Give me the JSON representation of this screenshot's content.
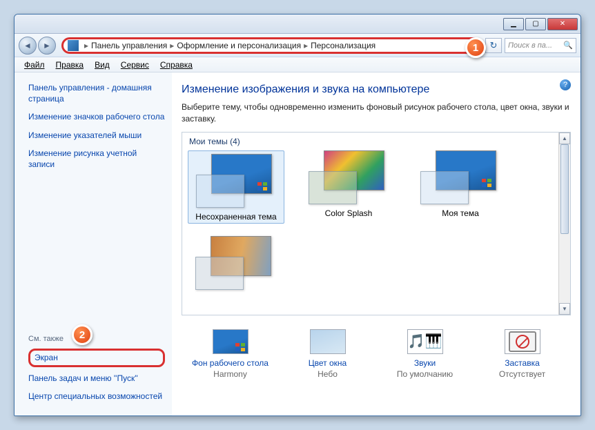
{
  "breadcrumb": {
    "items": [
      "Панель управления",
      "Оформление и персонализация",
      "Персонализация"
    ]
  },
  "search": {
    "placeholder": "Поиск в па..."
  },
  "menu": {
    "file": "Файл",
    "edit": "Правка",
    "view": "Вид",
    "tools": "Сервис",
    "help": "Справка"
  },
  "sidebar": {
    "home": "Панель управления - домашняя страница",
    "icons": "Изменение значков рабочего стола",
    "pointers": "Изменение указателей мыши",
    "accpic": "Изменение рисунка учетной записи",
    "seealso": "См. также",
    "screen": "Экран",
    "taskbar": "Панель задач и меню ''Пуск''",
    "ease": "Центр специальных возможностей"
  },
  "main": {
    "heading": "Изменение изображения и звука на компьютере",
    "subtext": "Выберите тему, чтобы одновременно изменить фоновый рисунок рабочего стола, цвет окна, звуки и заставку.",
    "group": "Мои темы (4)",
    "themes": [
      "Несохраненная тема",
      "Color Splash",
      "Моя тема"
    ]
  },
  "footer": {
    "wall": {
      "link": "Фон рабочего стола",
      "val": "Harmony"
    },
    "color": {
      "link": "Цвет окна",
      "val": "Небо"
    },
    "sound": {
      "link": "Звуки",
      "val": "По умолчанию"
    },
    "saver": {
      "link": "Заставка",
      "val": "Отсутствует"
    }
  },
  "callouts": {
    "one": "1",
    "two": "2"
  }
}
